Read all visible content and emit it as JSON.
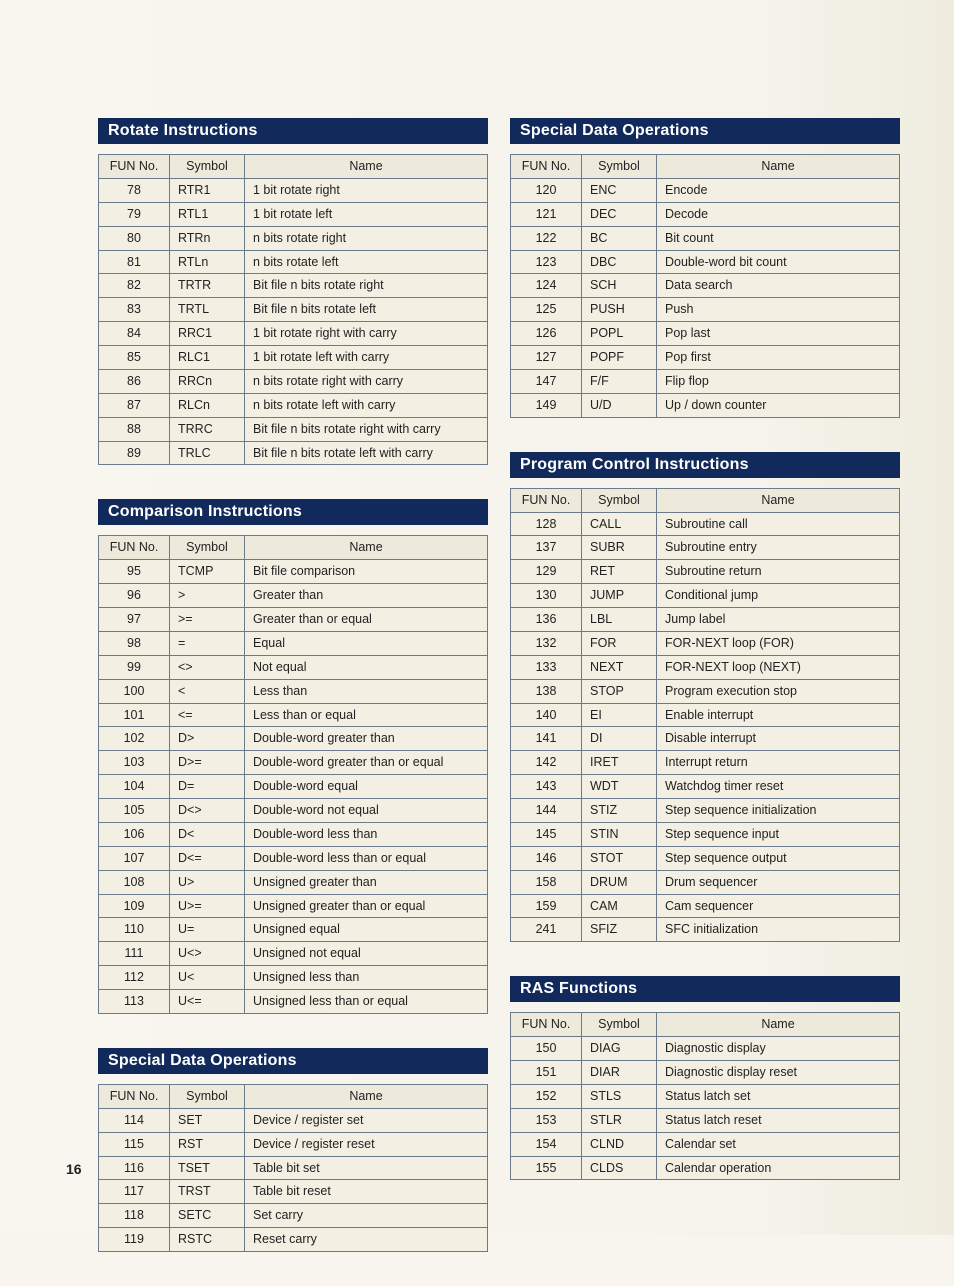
{
  "pageNumber": "16",
  "headers": {
    "fun": "FUN No.",
    "symbol": "Symbol",
    "name": "Name"
  },
  "leftSections": [
    {
      "title": "Rotate Instructions",
      "rows": [
        {
          "fun": "78",
          "sym": "RTR1",
          "name": "1 bit rotate right"
        },
        {
          "fun": "79",
          "sym": "RTL1",
          "name": "1 bit rotate left"
        },
        {
          "fun": "80",
          "sym": "RTRn",
          "name": "n bits rotate right"
        },
        {
          "fun": "81",
          "sym": "RTLn",
          "name": "n bits rotate left"
        },
        {
          "fun": "82",
          "sym": "TRTR",
          "name": "Bit file n bits rotate right"
        },
        {
          "fun": "83",
          "sym": "TRTL",
          "name": "Bit file n bits rotate left"
        },
        {
          "fun": "84",
          "sym": "RRC1",
          "name": "1 bit rotate right with carry"
        },
        {
          "fun": "85",
          "sym": "RLC1",
          "name": "1 bit rotate left with carry"
        },
        {
          "fun": "86",
          "sym": "RRCn",
          "name": "n bits rotate right with carry"
        },
        {
          "fun": "87",
          "sym": "RLCn",
          "name": "n bits rotate left with carry"
        },
        {
          "fun": "88",
          "sym": "TRRC",
          "name": "Bit file n bits rotate right with carry"
        },
        {
          "fun": "89",
          "sym": "TRLC",
          "name": "Bit file n bits rotate left with carry"
        }
      ]
    },
    {
      "title": "Comparison Instructions",
      "rows": [
        {
          "fun": "95",
          "sym": "TCMP",
          "name": "Bit file comparison"
        },
        {
          "fun": "96",
          "sym": ">",
          "name": "Greater than"
        },
        {
          "fun": "97",
          "sym": ">=",
          "name": "Greater than or equal"
        },
        {
          "fun": "98",
          "sym": "=",
          "name": "Equal"
        },
        {
          "fun": "99",
          "sym": "<>",
          "name": "Not equal"
        },
        {
          "fun": "100",
          "sym": "<",
          "name": "Less than"
        },
        {
          "fun": "101",
          "sym": "<=",
          "name": "Less than or equal"
        },
        {
          "fun": "102",
          "sym": "D>",
          "name": "Double-word greater than"
        },
        {
          "fun": "103",
          "sym": "D>=",
          "name": "Double-word greater than or equal"
        },
        {
          "fun": "104",
          "sym": "D=",
          "name": "Double-word equal"
        },
        {
          "fun": "105",
          "sym": "D<>",
          "name": "Double-word not equal"
        },
        {
          "fun": "106",
          "sym": "D<",
          "name": "Double-word less than"
        },
        {
          "fun": "107",
          "sym": "D<=",
          "name": "Double-word less than or equal"
        },
        {
          "fun": "108",
          "sym": "U>",
          "name": "Unsigned greater than"
        },
        {
          "fun": "109",
          "sym": "U>=",
          "name": "Unsigned greater than or equal"
        },
        {
          "fun": "110",
          "sym": "U=",
          "name": "Unsigned equal"
        },
        {
          "fun": "111",
          "sym": "U<>",
          "name": "Unsigned not equal"
        },
        {
          "fun": "112",
          "sym": "U<",
          "name": "Unsigned less than"
        },
        {
          "fun": "113",
          "sym": "U<=",
          "name": "Unsigned less than or equal"
        }
      ]
    },
    {
      "title": "Special Data Operations",
      "rows": [
        {
          "fun": "114",
          "sym": "SET",
          "name": "Device / register set"
        },
        {
          "fun": "115",
          "sym": "RST",
          "name": "Device / register reset"
        },
        {
          "fun": "116",
          "sym": "TSET",
          "name": "Table bit set"
        },
        {
          "fun": "117",
          "sym": "TRST",
          "name": "Table bit reset"
        },
        {
          "fun": "118",
          "sym": "SETC",
          "name": "Set carry"
        },
        {
          "fun": "119",
          "sym": "RSTC",
          "name": "Reset carry"
        }
      ]
    }
  ],
  "rightSections": [
    {
      "title": "Special Data Operations",
      "rows": [
        {
          "fun": "120",
          "sym": "ENC",
          "name": "Encode"
        },
        {
          "fun": "121",
          "sym": "DEC",
          "name": "Decode"
        },
        {
          "fun": "122",
          "sym": "BC",
          "name": "Bit count"
        },
        {
          "fun": "123",
          "sym": "DBC",
          "name": "Double-word bit count"
        },
        {
          "fun": "124",
          "sym": "SCH",
          "name": "Data search"
        },
        {
          "fun": "125",
          "sym": "PUSH",
          "name": "Push"
        },
        {
          "fun": "126",
          "sym": "POPL",
          "name": "Pop last"
        },
        {
          "fun": "127",
          "sym": "POPF",
          "name": "Pop first"
        },
        {
          "fun": "147",
          "sym": "F/F",
          "name": "Flip flop"
        },
        {
          "fun": "149",
          "sym": "U/D",
          "name": "Up / down counter"
        }
      ]
    },
    {
      "title": "Program Control Instructions",
      "rows": [
        {
          "fun": "128",
          "sym": "CALL",
          "name": "Subroutine call"
        },
        {
          "fun": "137",
          "sym": "SUBR",
          "name": "Subroutine entry"
        },
        {
          "fun": "129",
          "sym": "RET",
          "name": "Subroutine return"
        },
        {
          "fun": "130",
          "sym": "JUMP",
          "name": "Conditional jump"
        },
        {
          "fun": "136",
          "sym": "LBL",
          "name": "Jump label"
        },
        {
          "fun": "132",
          "sym": "FOR",
          "name": "FOR-NEXT loop (FOR)"
        },
        {
          "fun": "133",
          "sym": "NEXT",
          "name": "FOR-NEXT loop (NEXT)"
        },
        {
          "fun": "138",
          "sym": "STOP",
          "name": "Program execution stop"
        },
        {
          "fun": "140",
          "sym": "EI",
          "name": "Enable interrupt"
        },
        {
          "fun": "141",
          "sym": "DI",
          "name": "Disable interrupt"
        },
        {
          "fun": "142",
          "sym": "IRET",
          "name": "Interrupt return"
        },
        {
          "fun": "143",
          "sym": "WDT",
          "name": "Watchdog timer reset"
        },
        {
          "fun": "144",
          "sym": "STIZ",
          "name": "Step sequence initialization"
        },
        {
          "fun": "145",
          "sym": "STIN",
          "name": "Step sequence input"
        },
        {
          "fun": "146",
          "sym": "STOT",
          "name": "Step sequence output"
        },
        {
          "fun": "158",
          "sym": "DRUM",
          "name": "Drum sequencer"
        },
        {
          "fun": "159",
          "sym": "CAM",
          "name": "Cam sequencer"
        },
        {
          "fun": "241",
          "sym": "SFIZ",
          "name": "SFC initialization"
        }
      ]
    },
    {
      "title": "RAS Functions",
      "rows": [
        {
          "fun": "150",
          "sym": "DIAG",
          "name": "Diagnostic display"
        },
        {
          "fun": "151",
          "sym": "DIAR",
          "name": "Diagnostic display reset"
        },
        {
          "fun": "152",
          "sym": "STLS",
          "name": "Status latch set"
        },
        {
          "fun": "153",
          "sym": "STLR",
          "name": "Status latch reset"
        },
        {
          "fun": "154",
          "sym": "CLND",
          "name": "Calendar set"
        },
        {
          "fun": "155",
          "sym": "CLDS",
          "name": "Calendar operation"
        }
      ]
    }
  ]
}
